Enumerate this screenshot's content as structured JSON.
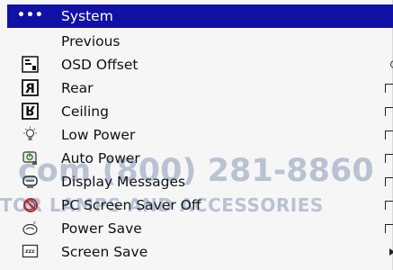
{
  "menu": {
    "header": {
      "dots": "•••",
      "title": "System"
    },
    "items": [
      {
        "label": "Previous",
        "icon": "",
        "control": ""
      },
      {
        "label": "OSD Offset",
        "icon": "osd-offset-icon",
        "control": "round"
      },
      {
        "label": "Rear",
        "icon": "rear-projection-icon",
        "control": "checkbox"
      },
      {
        "label": "Ceiling",
        "icon": "ceiling-mount-icon",
        "control": "checkbox"
      },
      {
        "label": "Low Power",
        "icon": "lamp-icon",
        "control": "checkbox"
      },
      {
        "label": "Auto Power",
        "icon": "auto-power-icon",
        "control": "checkbox"
      },
      {
        "label": "Display Messages",
        "icon": "display-messages-icon",
        "control": "checkbox"
      },
      {
        "label": "PC Screen Saver Off",
        "icon": "screen-saver-off-icon",
        "control": "checkbox"
      },
      {
        "label": "Power Save",
        "icon": "power-save-icon",
        "control": "checkbox"
      },
      {
        "label": "Screen Save",
        "icon": "screen-save-icon",
        "control": "submenu-arrow"
      }
    ]
  },
  "watermark": {
    "line1": "com (800) 281-8860",
    "line2": "TOR LAMPS AND ACCESSORIES"
  }
}
